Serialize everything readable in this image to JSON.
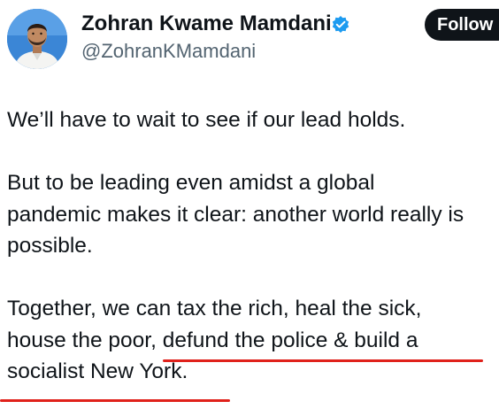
{
  "author": {
    "display_name": "Zohran Kwame Mamdani",
    "handle": "@ZohranKMamdani",
    "verified_icon": "verified-badge-icon"
  },
  "actions": {
    "follow_label": "Follow"
  },
  "tweet": {
    "lines": [
      "We’ll have to wait to see if our lead holds.",
      "",
      "But to be leading even amidst a global",
      "pandemic makes it clear: another world really is",
      "possible.",
      "",
      "Together, we can tax the rich, heal the sick,",
      "house the poor, defund the police & build a",
      "socialist New York."
    ]
  },
  "colors": {
    "text": "#0f1419",
    "handle": "#536471",
    "follow_bg": "#0f1419",
    "verified": "#1d9bf0",
    "annotation_underline": "#e0211b"
  }
}
